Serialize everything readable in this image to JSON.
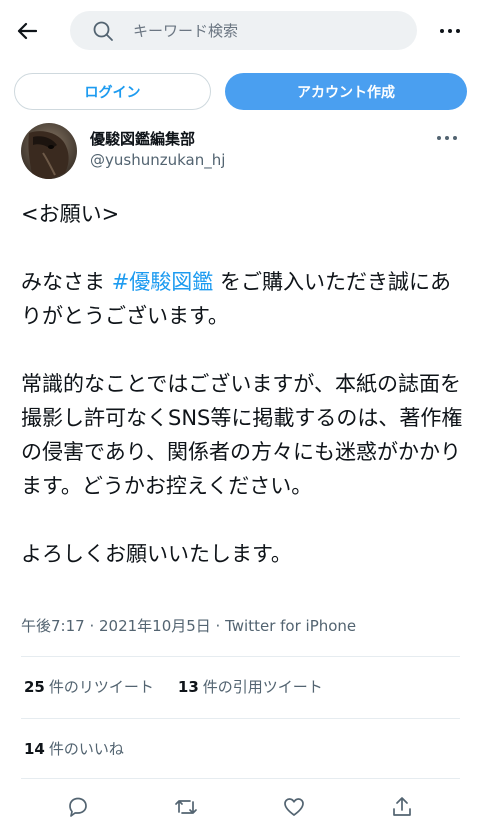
{
  "search": {
    "placeholder": "キーワード検索"
  },
  "auth": {
    "login_label": "ログイン",
    "signup_label": "アカウント作成"
  },
  "author": {
    "name": "優駿図鑑編集部",
    "handle": "@yushunzukan_hj"
  },
  "tweet": {
    "para1": "<お願い>",
    "para2_prefix": "みなさま ",
    "para2_hashtag": "#優駿図鑑",
    "para2_suffix": " をご購入いただき誠にありがとうございます。",
    "para3": "常識的なことではございますが、本紙の誌面を撮影し許可なくSNS等に掲載するのは、著作権の侵害であり、関係者の方々にも迷惑がかかります。どうかお控えください。",
    "para4": "よろしくお願いいたします。"
  },
  "meta": {
    "text": "午後7:17 · 2021年10月5日 · Twitter for iPhone"
  },
  "stats": {
    "retweets_count": "25",
    "retweets_label": "件のリツイート",
    "quotes_count": "13",
    "quotes_label": "件の引用ツイート",
    "likes_count": "14",
    "likes_label": "件のいいね"
  },
  "colors": {
    "accent": "#1d9bf0",
    "signup_bg": "#4a9ff0",
    "muted": "#536471"
  },
  "icons": [
    "back-arrow-icon",
    "search-icon",
    "more-icon",
    "reply-icon",
    "retweet-icon",
    "like-icon",
    "share-icon"
  ]
}
